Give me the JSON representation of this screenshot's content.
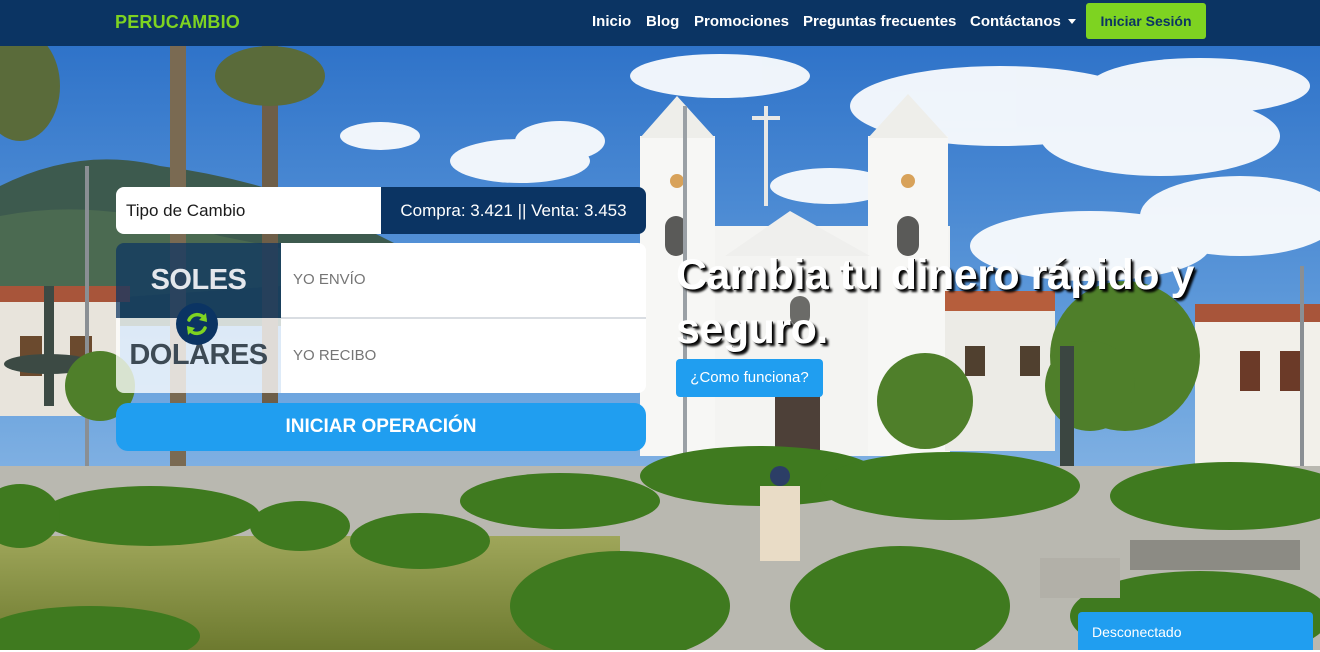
{
  "navbar": {
    "brand": "PERUCAMBIO",
    "links": [
      "Inicio",
      "Blog",
      "Promociones",
      "Preguntas frecuentes",
      "Contáctanos"
    ],
    "login_label": "Iniciar Sesión"
  },
  "rate": {
    "label": "Tipo de Cambio",
    "value": "Compra: 3.421 || Venta: 3.453"
  },
  "converter": {
    "send_currency": "SOLES",
    "receive_currency": "DOLARES",
    "send_placeholder": "YO ENVÍO",
    "receive_placeholder": "YO RECIBO",
    "submit_label": "INICIAR OPERACIÓN"
  },
  "hero": {
    "headline": "Cambia tu dinero rápido y seguro.",
    "how_label": "¿Como funciona?"
  },
  "status": {
    "label": "Desconectado"
  },
  "colors": {
    "navbar_bg": "#0b3463",
    "brand_green": "#7ed321",
    "accent_blue": "#209ef0"
  },
  "icons": {
    "swap": "refresh-icon",
    "dropdown": "caret-down-icon"
  }
}
